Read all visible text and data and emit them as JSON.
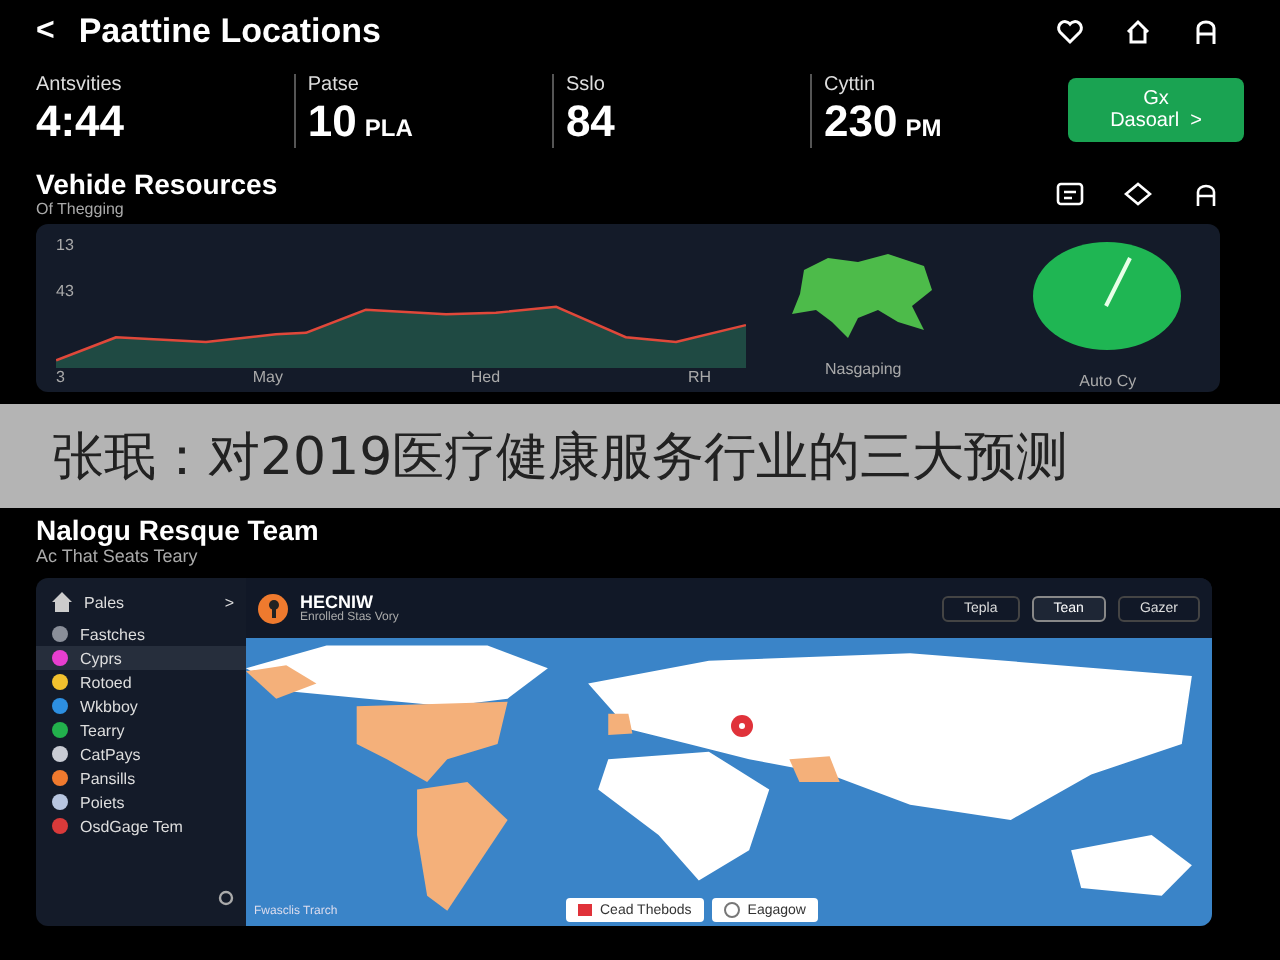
{
  "header": {
    "back": "<",
    "title": "Paattine Locations"
  },
  "stats": [
    {
      "label": "Antsvities",
      "value": "4:44"
    },
    {
      "label": "Patse",
      "value": "10",
      "unit": "PLA"
    },
    {
      "label": "Sslo",
      "value": "84"
    },
    {
      "label": "Cyttin",
      "value": "230",
      "unit": "PM"
    }
  ],
  "stats_button": {
    "label": "Gx Dasoarl",
    "arrow": ">"
  },
  "section": {
    "title": "Vehide Resources",
    "subtitle": "Of Thegging"
  },
  "chart_panel": {
    "y_labels": [
      "13",
      "43"
    ],
    "x_labels": [
      "3",
      "May",
      "Hed",
      "RH"
    ],
    "map_label": "Nasgaping",
    "gauge_label": "Auto Cy"
  },
  "team": {
    "title": "Nalogu Resque Team",
    "subtitle": "Ac That Seats Teary"
  },
  "sidebar": {
    "header": "Pales",
    "header_arrow": ">",
    "items": [
      {
        "label": "Fastches",
        "color": "#8a8f99",
        "selected": false
      },
      {
        "label": "Cyprs",
        "color": "#e83ecf",
        "selected": true
      },
      {
        "label": "Rotoed",
        "color": "#f2c12e",
        "selected": false
      },
      {
        "label": "Wkbboy",
        "color": "#2d8fe0",
        "selected": false
      },
      {
        "label": "Tearry",
        "color": "#22b14c",
        "selected": false
      },
      {
        "label": "CatPays",
        "color": "#c9ccd4",
        "selected": false
      },
      {
        "label": "Pansills",
        "color": "#f07a2e",
        "selected": false
      },
      {
        "label": "Poiets",
        "color": "#b8c6e0",
        "selected": false
      },
      {
        "label": "OsdGage Tem",
        "color": "#d93a3a",
        "selected": false
      }
    ]
  },
  "map_panel": {
    "title": "HECNIW",
    "subtitle": "Enrolled Stas Vory",
    "buttons": [
      {
        "label": "Tepla",
        "selected": false
      },
      {
        "label": "Tean",
        "selected": true
      },
      {
        "label": "Gazer",
        "selected": false
      }
    ],
    "footnote": "Fwasclis Trarch",
    "legend": [
      "Cead Thebods",
      "Eagagow"
    ]
  },
  "banner": "张珉：对2019医疗健康服务行业的三大预测"
}
